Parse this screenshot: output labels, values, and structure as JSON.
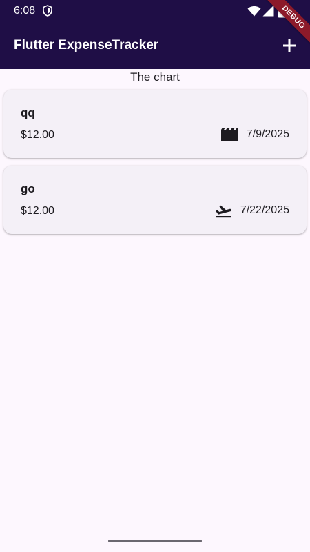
{
  "status_bar": {
    "time": "6:08",
    "icons": [
      "shield-icon",
      "wifi-icon",
      "signal-icon",
      "battery-icon"
    ]
  },
  "app_bar": {
    "title": "Flutter ExpenseTracker",
    "add_icon": "plus-icon",
    "background_color": "#1f0e46"
  },
  "debug_banner": "DEBUG",
  "chart": {
    "label": "The chart"
  },
  "expenses": [
    {
      "title": "qq",
      "amount": "$12.00",
      "category_icon": "movie-icon",
      "date": "7/9/2025"
    },
    {
      "title": "go",
      "amount": "$12.00",
      "category_icon": "flight-takeoff-icon",
      "date": "7/22/2025"
    }
  ],
  "colors": {
    "surface": "#fdf7fe",
    "card": "#f4f0f7",
    "text": "#1d1b20"
  }
}
